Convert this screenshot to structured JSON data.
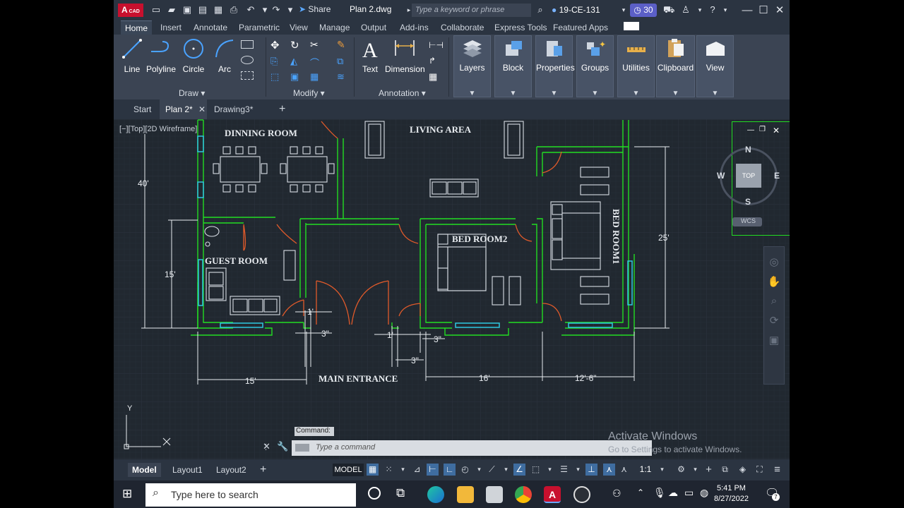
{
  "app": {
    "logo": "A",
    "logo_sub": "CAD",
    "doc_title": "Plan 2.dwg",
    "share_label": "Share",
    "search_placeholder": "Type a keyword or phrase",
    "user": "19-CE-131",
    "timer": "30"
  },
  "ribbon_tabs": [
    "Home",
    "Insert",
    "Annotate",
    "Parametric",
    "View",
    "Manage",
    "Output",
    "Add-ins",
    "Collaborate",
    "Express Tools",
    "Featured Apps"
  ],
  "ribbon": {
    "draw": [
      "Line",
      "Polyline",
      "Circle",
      "Arc"
    ],
    "draw_panel": "Draw",
    "modify_panel": "Modify",
    "annotation": [
      "Text",
      "Dimension"
    ],
    "annotation_panel": "Annotation",
    "tiles": [
      "Layers",
      "Block",
      "Properties",
      "Groups",
      "Utilities",
      "Clipboard",
      "View"
    ]
  },
  "file_tabs": [
    "Start",
    "Plan 2*",
    "Drawing3*"
  ],
  "viewport_label": "[−][Top][2D Wireframe]",
  "plan": {
    "rooms": [
      "DINNING ROOM",
      "LIVING AREA",
      "BED ROOM2",
      "BED ROOM1",
      "GUEST ROOM",
      "MAIN ENTRANCE"
    ],
    "dims": [
      "40'",
      "15'",
      "25'",
      "15'",
      "16'",
      "12'-6\"",
      "1'",
      "3\"",
      "1'",
      "3\"",
      "3\""
    ]
  },
  "viewcube": {
    "n": "N",
    "s": "S",
    "e": "E",
    "w": "W",
    "top": "TOP",
    "wcs": "WCS"
  },
  "ucs": {
    "x": "X",
    "y": "Y"
  },
  "command": {
    "history_label": "Command:",
    "placeholder": "Type  a  command"
  },
  "watermark": {
    "line1": "Activate Windows",
    "line2": "Go to Settings to activate Windows."
  },
  "status": {
    "tabs": [
      "Model",
      "Layout1",
      "Layout2"
    ],
    "model_button": "MODEL",
    "scale": "1:1"
  },
  "taskbar": {
    "search_placeholder": "Type here to search",
    "time": "5:41 PM",
    "date": "8/27/2022",
    "notif_count": "7"
  },
  "colors": {
    "wall": "#22dd22",
    "door": "#e05a2a",
    "window": "#2ec7e0",
    "furniture": "#d8dde4",
    "dimension": "#ffffff"
  }
}
